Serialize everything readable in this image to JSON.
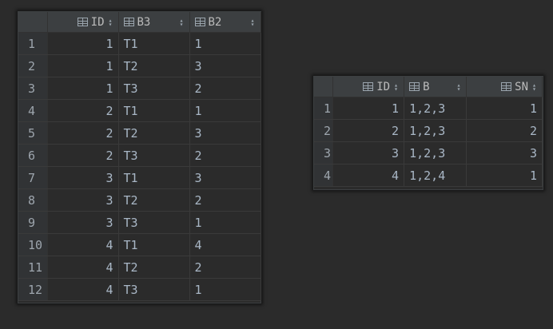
{
  "left_grid": {
    "columns": [
      {
        "label": "ID"
      },
      {
        "label": "B3"
      },
      {
        "label": "B2"
      }
    ],
    "rows": [
      {
        "n": "1",
        "id": "1",
        "b3": "T1",
        "b2": "1"
      },
      {
        "n": "2",
        "id": "1",
        "b3": "T2",
        "b2": "3"
      },
      {
        "n": "3",
        "id": "1",
        "b3": "T3",
        "b2": "2"
      },
      {
        "n": "4",
        "id": "2",
        "b3": "T1",
        "b2": "1"
      },
      {
        "n": "5",
        "id": "2",
        "b3": "T2",
        "b2": "3"
      },
      {
        "n": "6",
        "id": "2",
        "b3": "T3",
        "b2": "2"
      },
      {
        "n": "7",
        "id": "3",
        "b3": "T1",
        "b2": "3"
      },
      {
        "n": "8",
        "id": "3",
        "b3": "T2",
        "b2": "2"
      },
      {
        "n": "9",
        "id": "3",
        "b3": "T3",
        "b2": "1"
      },
      {
        "n": "10",
        "id": "4",
        "b3": "T1",
        "b2": "4"
      },
      {
        "n": "11",
        "id": "4",
        "b3": "T2",
        "b2": "2"
      },
      {
        "n": "12",
        "id": "4",
        "b3": "T3",
        "b2": "1"
      }
    ]
  },
  "right_grid": {
    "columns": [
      {
        "label": "ID"
      },
      {
        "label": "B"
      },
      {
        "label": "SN"
      }
    ],
    "rows": [
      {
        "n": "1",
        "id": "1",
        "b": "1,2,3",
        "sn": "1"
      },
      {
        "n": "2",
        "id": "2",
        "b": "1,2,3",
        "sn": "2"
      },
      {
        "n": "3",
        "id": "3",
        "b": "1,2,3",
        "sn": "3"
      },
      {
        "n": "4",
        "id": "4",
        "b": "1,2,4",
        "sn": "1"
      }
    ]
  },
  "icons": {
    "column": "table-column-icon",
    "sort": "sort-arrows-icon"
  },
  "colors": {
    "background": "#2b2b2b",
    "header": "#3c3f41",
    "rownum_gutter": "#313335",
    "text": "#a9b7c6"
  }
}
